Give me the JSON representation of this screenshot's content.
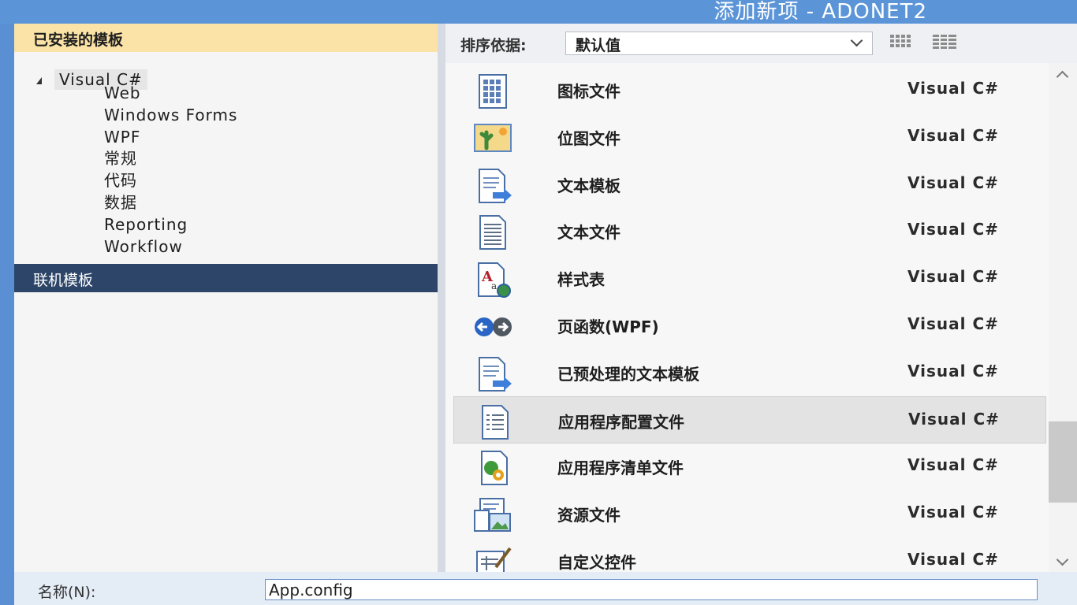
{
  "window": {
    "title": "添加新项 - ADONET2"
  },
  "sidebar": {
    "installed_header": "已安装的模板",
    "tree_root": "Visual C#",
    "tree_children": [
      "Web",
      "Windows Forms",
      "WPF",
      "常规",
      "代码",
      "数据",
      "Reporting",
      "Workflow"
    ],
    "online_templates": "联机模板"
  },
  "toolbar": {
    "sort_label": "排序依据:",
    "sort_value": "默认值",
    "view_buttons": [
      "list-view-icon",
      "detail-view-icon"
    ]
  },
  "templates": [
    {
      "name": "图标文件",
      "language": "Visual C#",
      "icon": "icon-file-icon"
    },
    {
      "name": "位图文件",
      "language": "Visual C#",
      "icon": "bitmap-file-icon"
    },
    {
      "name": "文本模板",
      "language": "Visual C#",
      "icon": "text-template-icon"
    },
    {
      "name": "文本文件",
      "language": "Visual C#",
      "icon": "text-file-icon"
    },
    {
      "name": "样式表",
      "language": "Visual C#",
      "icon": "stylesheet-icon"
    },
    {
      "name": "页函数(WPF)",
      "language": "Visual C#",
      "icon": "page-function-icon"
    },
    {
      "name": "已预处理的文本模板",
      "language": "Visual C#",
      "icon": "preprocessed-template-icon"
    },
    {
      "name": "应用程序配置文件",
      "language": "Visual C#",
      "icon": "app-config-icon",
      "selected": true
    },
    {
      "name": "应用程序清单文件",
      "language": "Visual C#",
      "icon": "app-manifest-icon"
    },
    {
      "name": "资源文件",
      "language": "Visual C#",
      "icon": "resource-file-icon"
    },
    {
      "name": "自定义控件",
      "language": "Visual C#",
      "icon": "custom-control-icon"
    }
  ],
  "bottom": {
    "name_label": "名称(N):",
    "name_value": "App.config"
  },
  "colors": {
    "title_bar": "#5b95d8",
    "installed_header": "#fbe3a7",
    "online_templates_bg": "#2d4568",
    "selected_row": "#e3e3e3"
  }
}
